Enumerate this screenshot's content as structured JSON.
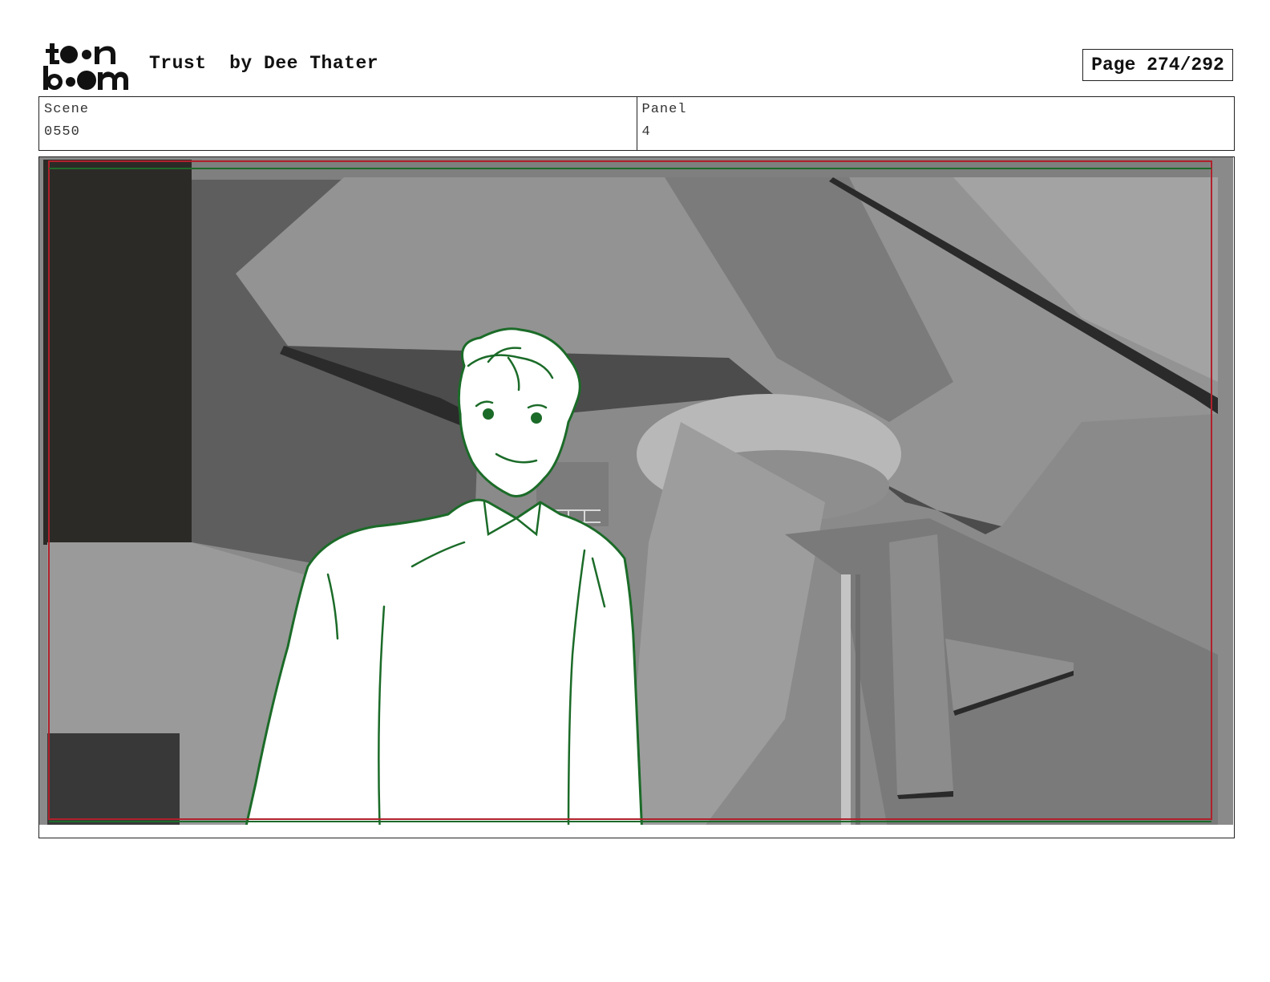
{
  "header": {
    "logo_text": "toon boom",
    "title": "Trust  by Dee Thater",
    "page_label": "Page 274/292"
  },
  "info": {
    "scene_label": "Scene",
    "scene_value": "0550",
    "panel_label": "Panel",
    "panel_value": "4"
  },
  "colors": {
    "safe_frame": "#b0212b",
    "title_safe": "#1e6a2a",
    "sketch_line": "#1b6b28"
  }
}
